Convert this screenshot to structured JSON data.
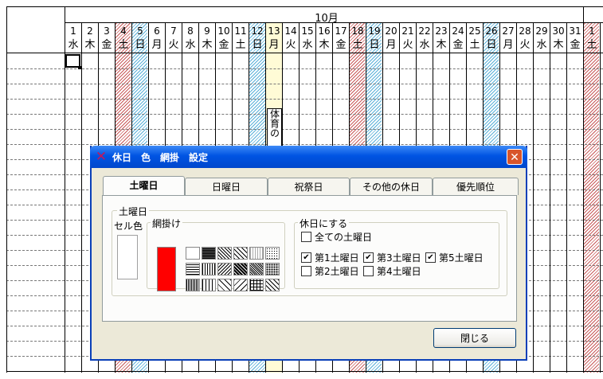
{
  "sheet": {
    "month": "10月",
    "days": [
      {
        "d": "1",
        "w": "水",
        "t": ""
      },
      {
        "d": "2",
        "w": "木",
        "t": ""
      },
      {
        "d": "3",
        "w": "金",
        "t": ""
      },
      {
        "d": "4",
        "w": "土",
        "t": "sat"
      },
      {
        "d": "5",
        "w": "日",
        "t": "sun"
      },
      {
        "d": "6",
        "w": "月",
        "t": ""
      },
      {
        "d": "7",
        "w": "火",
        "t": ""
      },
      {
        "d": "8",
        "w": "水",
        "t": ""
      },
      {
        "d": "9",
        "w": "木",
        "t": ""
      },
      {
        "d": "10",
        "w": "金",
        "t": ""
      },
      {
        "d": "11",
        "w": "土",
        "t": ""
      },
      {
        "d": "12",
        "w": "日",
        "t": "sun"
      },
      {
        "d": "13",
        "w": "月",
        "t": "hol"
      },
      {
        "d": "14",
        "w": "火",
        "t": ""
      },
      {
        "d": "15",
        "w": "水",
        "t": ""
      },
      {
        "d": "16",
        "w": "木",
        "t": ""
      },
      {
        "d": "17",
        "w": "金",
        "t": ""
      },
      {
        "d": "18",
        "w": "土",
        "t": "sat"
      },
      {
        "d": "19",
        "w": "日",
        "t": "sun"
      },
      {
        "d": "20",
        "w": "月",
        "t": ""
      },
      {
        "d": "21",
        "w": "火",
        "t": ""
      },
      {
        "d": "22",
        "w": "水",
        "t": ""
      },
      {
        "d": "23",
        "w": "木",
        "t": ""
      },
      {
        "d": "24",
        "w": "金",
        "t": ""
      },
      {
        "d": "25",
        "w": "土",
        "t": ""
      },
      {
        "d": "26",
        "w": "日",
        "t": "sun"
      },
      {
        "d": "27",
        "w": "月",
        "t": ""
      },
      {
        "d": "28",
        "w": "火",
        "t": ""
      },
      {
        "d": "29",
        "w": "水",
        "t": ""
      },
      {
        "d": "30",
        "w": "木",
        "t": ""
      },
      {
        "d": "31",
        "w": "金",
        "t": ""
      },
      {
        "d": "1",
        "w": "土",
        "t": "sat"
      }
    ],
    "event_text": "体育の"
  },
  "dialog": {
    "title": "休日　色　網掛　設定",
    "tabs": [
      "土曜日",
      "日曜日",
      "祝祭日",
      "その他の休日",
      "優先順位"
    ],
    "group_main": "土曜日",
    "cell_color_label": "セル色",
    "pattern_label": "網掛け",
    "holiday_group_label": "休日にする",
    "checkbox_all": {
      "label": "全ての土曜日",
      "checked": false
    },
    "checkboxes": [
      {
        "label": "第1土曜日",
        "checked": true
      },
      {
        "label": "第3土曜日",
        "checked": true
      },
      {
        "label": "第5土曜日",
        "checked": true
      },
      {
        "label": "第2土曜日",
        "checked": false
      },
      {
        "label": "第4土曜日",
        "checked": false
      }
    ],
    "close_button": "閉じる",
    "colors": {
      "accent": "#ff0000",
      "title_bar": "#0054e3",
      "saturday": "#c85a5a",
      "sunday": "#5ab0d8"
    }
  }
}
